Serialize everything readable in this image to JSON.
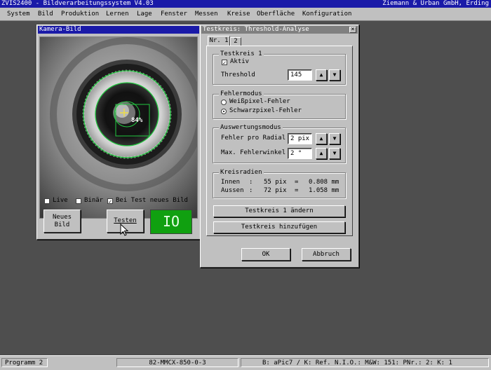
{
  "app": {
    "title": "ZVIS2400 - Bildverarbeitungssystem V4.03",
    "company": "Ziemann & Urban GmbH, Erding"
  },
  "menu": [
    {
      "id": "system",
      "label": "System"
    },
    {
      "id": "bild",
      "label": "Bild"
    },
    {
      "id": "produktion",
      "label": "Produktion"
    },
    {
      "id": "lernen",
      "label": "Lernen"
    },
    {
      "id": "lage",
      "label": "Lage"
    },
    {
      "id": "fenster",
      "label": "Fenster"
    },
    {
      "id": "messen",
      "label": "Messen"
    },
    {
      "id": "kreise",
      "label": "Kreise"
    },
    {
      "id": "oberflaeche",
      "label": "Oberfläche"
    },
    {
      "id": "konfiguration",
      "label": "Konfiguration"
    }
  ],
  "camera_window": {
    "title": "Kamera-Bild",
    "overlay_percent": "84%",
    "checkbox_live": {
      "label": "Live",
      "checked": false
    },
    "checkbox_binaer": {
      "label": "Binär",
      "checked": false
    },
    "checkbox_bei_test": {
      "label": "Bei Test neues Bild",
      "checked": true
    },
    "new_image_button": {
      "line1": "Neues",
      "line2": "Bild"
    },
    "test_button": "Testen",
    "result": {
      "text": "IO",
      "color": "#10a010"
    }
  },
  "dialog": {
    "title": "Testkreis: Threshold-Analyse",
    "close_symbol": "×",
    "tabs": [
      {
        "label": "Nr. 1",
        "active": true
      },
      {
        "label": "2",
        "active": false
      }
    ],
    "testkreis": {
      "group_title": "Testkreis 1",
      "aktiv_label": "Aktiv",
      "aktiv_checked": true,
      "threshold_label": "Threshold",
      "threshold_value": "145"
    },
    "fehlermodus": {
      "group_title": "Fehlermodus",
      "options": [
        {
          "label": "Weißpixel-Fehler",
          "selected": false
        },
        {
          "label": "Schwarzpixel-Fehler",
          "selected": true
        }
      ]
    },
    "auswertung": {
      "group_title": "Auswertungsmodus",
      "fehler_label": "Fehler pro Radial",
      "fehler_value": "2 pix",
      "winkel_label": "Max. Fehlerwinkel",
      "winkel_value": "2 °"
    },
    "kreisradien": {
      "group_title": "Kreisradien",
      "rows": [
        {
          "name": "Innen",
          "sep": ":",
          "pix": "55 pix",
          "eq": "=",
          "mm": "0.808 mm"
        },
        {
          "name": "Aussen",
          "sep": ":",
          "pix": "72 pix",
          "eq": "=",
          "mm": "1.058 mm"
        }
      ]
    },
    "aendern_button": "Testkreis 1 ändern",
    "hinzufuegen_button": "Testkreis hinzufügen",
    "ok_button": "OK",
    "abbruch_button": "Abbruch",
    "arrow_up": "▲",
    "arrow_down": "▼"
  },
  "status": {
    "programm": "Programm 2",
    "part": "82-MMCX-850-0-3",
    "info": "B: aPic7 / K: Ref. N.I.O.: M&W: 151: PNr.: 2: K: 1"
  }
}
